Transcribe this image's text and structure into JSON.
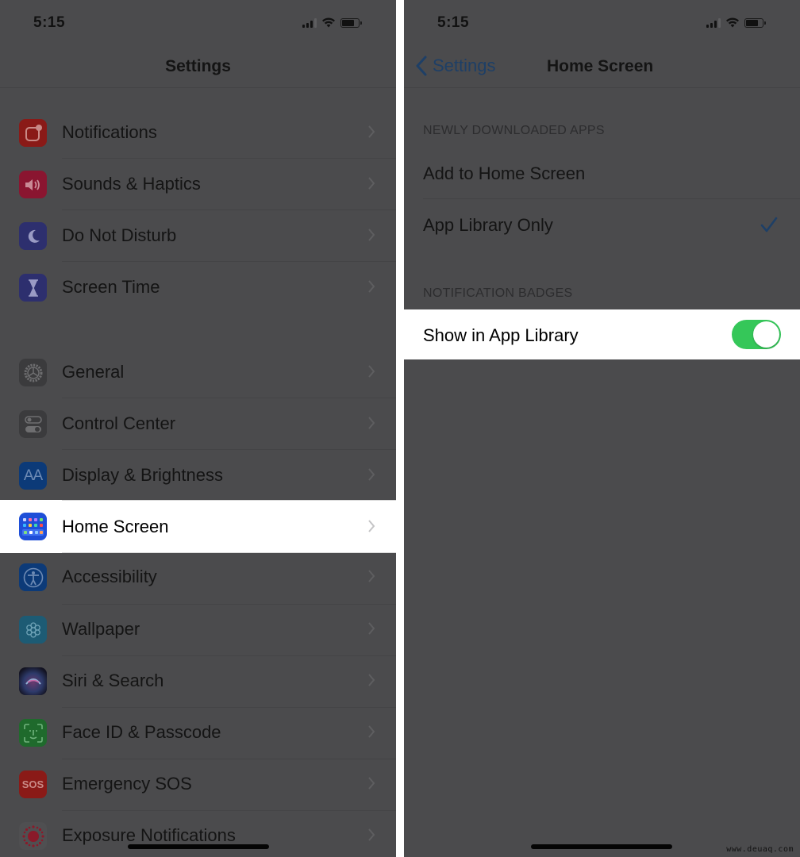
{
  "left": {
    "status": {
      "time": "5:15"
    },
    "nav": {
      "title": "Settings"
    },
    "groups": [
      {
        "items": [
          {
            "label": "Notifications",
            "icon": "notifications-icon",
            "color": "#8a1a17"
          },
          {
            "label": "Sounds & Haptics",
            "icon": "speaker-icon",
            "color": "#8a1530"
          },
          {
            "label": "Do Not Disturb",
            "icon": "moon-icon",
            "color": "#2d2f6e"
          },
          {
            "label": "Screen Time",
            "icon": "hourglass-icon",
            "color": "#2d2f6e"
          }
        ]
      },
      {
        "items": [
          {
            "label": "General",
            "icon": "gear-icon",
            "color": "#3b3b3d"
          },
          {
            "label": "Control Center",
            "icon": "toggles-icon",
            "color": "#3b3b3d"
          },
          {
            "label": "Display & Brightness",
            "icon": "text-size-icon",
            "color": "#0c3a78"
          },
          {
            "label": "Home Screen",
            "icon": "home-screen-grid-icon",
            "color": "#1f4fd8",
            "highlighted": true
          },
          {
            "label": "Accessibility",
            "icon": "accessibility-icon",
            "color": "#0c3a78"
          },
          {
            "label": "Wallpaper",
            "icon": "flower-icon",
            "color": "#1d5b74"
          },
          {
            "label": "Siri & Search",
            "icon": "siri-icon",
            "color": "#1a1a2e"
          },
          {
            "label": "Face ID & Passcode",
            "icon": "face-id-icon",
            "color": "#1f6a2c"
          },
          {
            "label": "Emergency SOS",
            "icon": "sos-icon",
            "color": "#8a1a17"
          },
          {
            "label": "Exposure Notifications",
            "icon": "exposure-icon",
            "color": "#4b4b4d"
          }
        ]
      }
    ],
    "sos_text": "SOS",
    "aa_text": "AA"
  },
  "right": {
    "status": {
      "time": "5:15"
    },
    "nav": {
      "back_label": "Settings",
      "title": "Home Screen"
    },
    "sections": [
      {
        "header": "NEWLY DOWNLOADED APPS",
        "options": [
          {
            "label": "Add to Home Screen",
            "selected": false
          },
          {
            "label": "App Library Only",
            "selected": true
          }
        ]
      },
      {
        "header": "NOTIFICATION BADGES",
        "toggles": [
          {
            "label": "Show in App Library",
            "on": true
          }
        ]
      }
    ]
  },
  "colors": {
    "dim_background": "#4b4b4d",
    "toggle_on": "#35c759",
    "accent_dimmed": "#1e3f66"
  },
  "watermark": "www.deuaq.com"
}
